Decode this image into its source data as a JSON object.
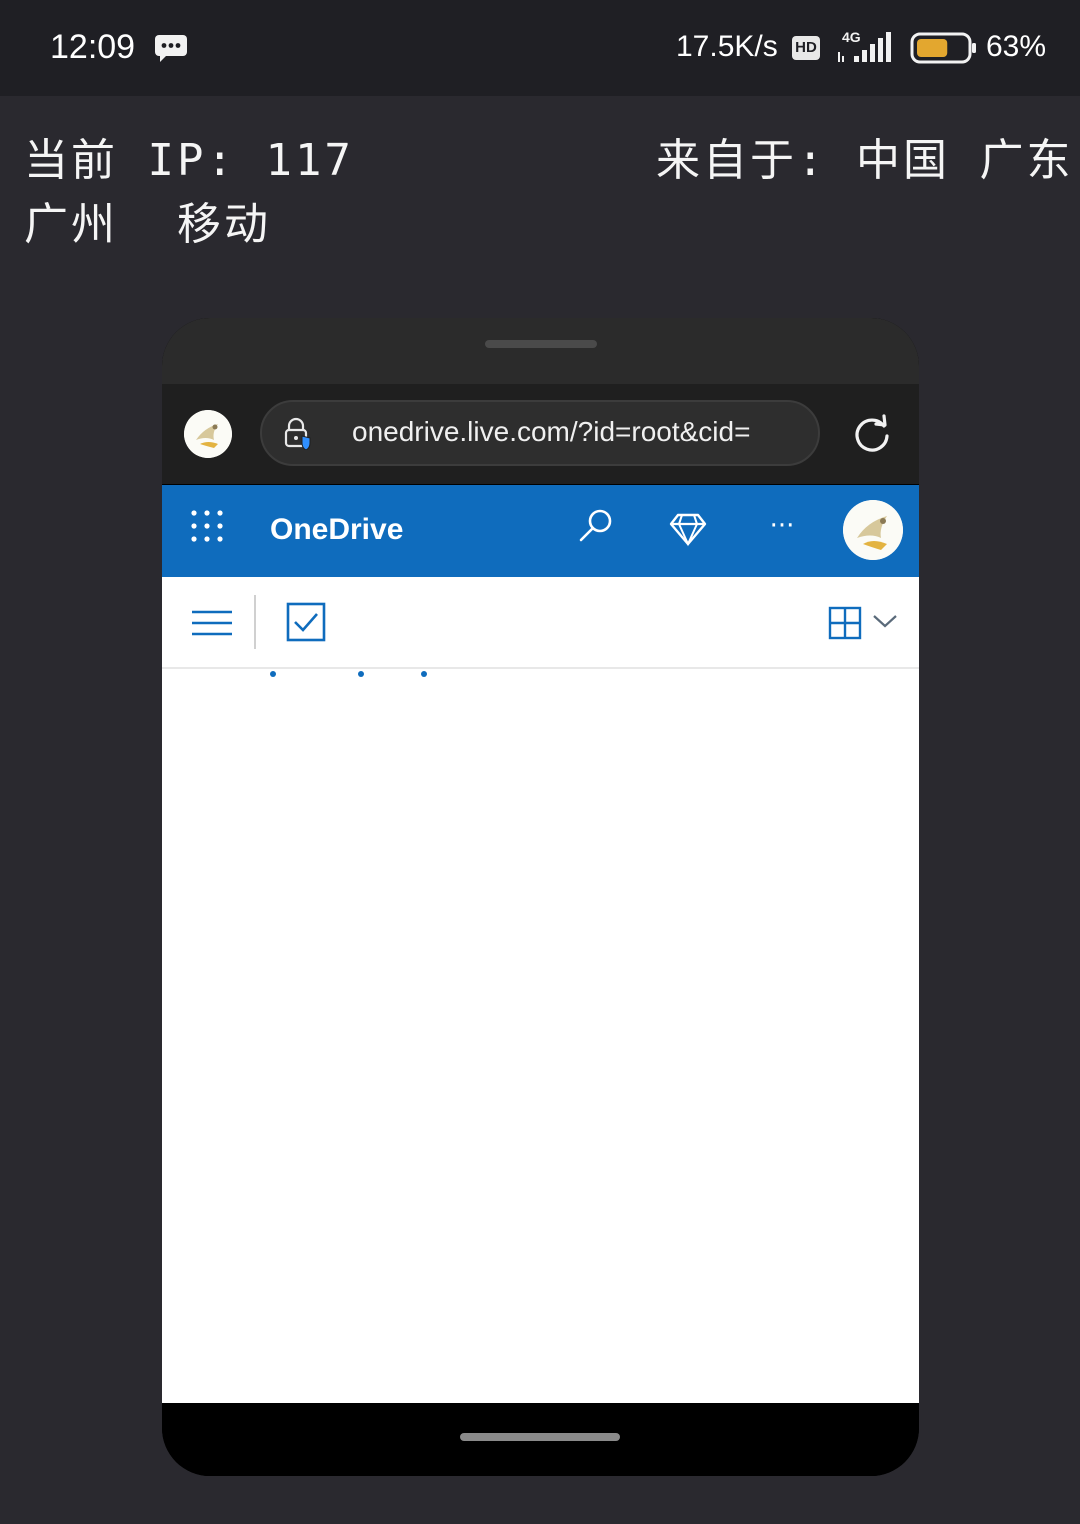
{
  "status_bar": {
    "time": "12:09",
    "net_speed": "17.5K/s",
    "hd_badge": "HD",
    "network_type": "4G",
    "battery_percent": "63%",
    "battery_level": 0.63,
    "battery_color": "#e3a72f",
    "icons": [
      "message-icon",
      "signal-icon",
      "battery-icon"
    ]
  },
  "info": {
    "ip_line": "当前 IP: 117",
    "from_line": "来自于: 中国 广东",
    "isp_line": "广州  移动"
  },
  "browser": {
    "url": "onedrive.live.com/?id=root&cid=",
    "icons": [
      "profile-avatar",
      "lock-shield-icon",
      "reload-icon"
    ]
  },
  "onedrive": {
    "title": "OneDrive",
    "more_label": "···",
    "accent_color": "#0f6cbd",
    "icons": [
      "waffle-icon",
      "search-icon",
      "premium-diamond-icon",
      "more-icon",
      "avatar"
    ]
  },
  "toolbar": {
    "icons": [
      "hamburger-menu-icon",
      "select-checkbox-icon",
      "grid-view-icon",
      "chevron-down-icon"
    ]
  }
}
